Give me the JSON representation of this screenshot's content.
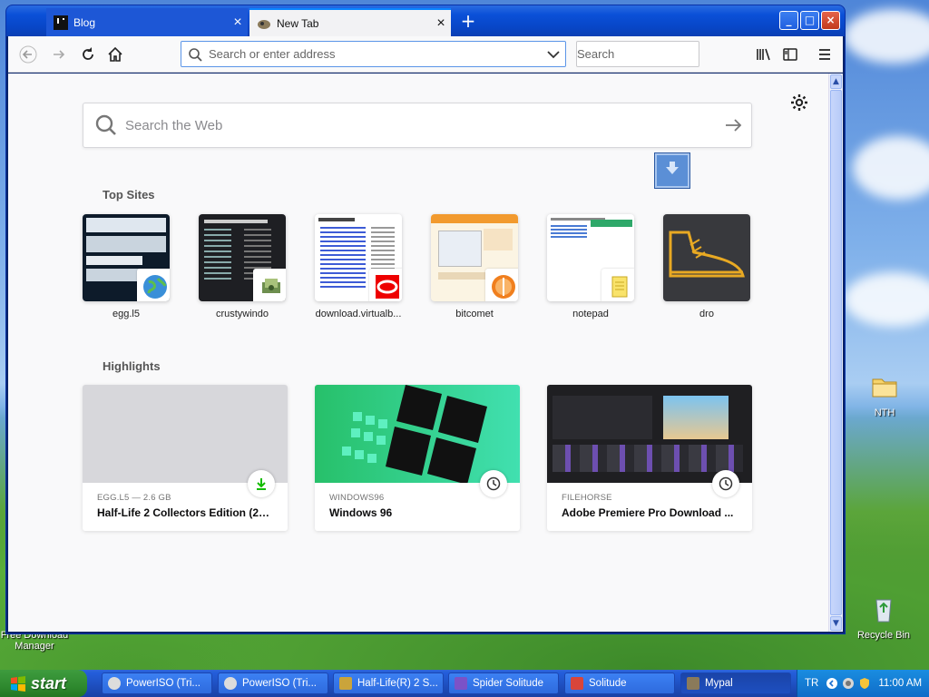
{
  "window": {
    "tabs": [
      {
        "label": "Blog",
        "icon": "blog-favicon"
      },
      {
        "label": "New Tab",
        "icon": "newtab-favicon"
      }
    ],
    "controls": {
      "minimize": "_",
      "maximize": "□",
      "close": "×"
    }
  },
  "toolbar": {
    "url_placeholder": "Search or enter address",
    "search_placeholder": "Search"
  },
  "newtab": {
    "web_search_placeholder": "Search the Web",
    "top_sites_title": "Top Sites",
    "top_sites": [
      {
        "name": "egg.l5",
        "badge": "globe-icon"
      },
      {
        "name": "crustywindo",
        "badge": "money-icon"
      },
      {
        "name": "download.virtualb...",
        "badge": "virtualbox-icon"
      },
      {
        "name": "bitcomet",
        "badge": "bitcomet-icon"
      },
      {
        "name": "notepad",
        "badge": "notepad-icon"
      },
      {
        "name": "dro",
        "badge": "sneaker-icon"
      }
    ],
    "highlights_title": "Highlights",
    "highlights": [
      {
        "source": "EGG.L5 — 2.6 GB",
        "title": "Half-Life 2 Collectors Edition (21...",
        "indicator": "download-icon"
      },
      {
        "source": "WINDOWS96",
        "title": "Windows 96",
        "indicator": "clock-icon"
      },
      {
        "source": "FILEHORSE",
        "title": "Adobe Premiere Pro Download ...",
        "indicator": "clock-icon"
      }
    ]
  },
  "desktop": {
    "icons": [
      {
        "label": "NTH"
      },
      {
        "label": "Recycle Bin"
      },
      {
        "label": "Free Download Manager"
      }
    ]
  },
  "taskbar": {
    "start_label": "start",
    "tasks": [
      {
        "label": "PowerISO (Tri..."
      },
      {
        "label": "PowerISO (Tri..."
      },
      {
        "label": "Half-Life(R) 2 S..."
      },
      {
        "label": "Spider Solitude"
      },
      {
        "label": "Solitude"
      },
      {
        "label": "Mypal"
      }
    ],
    "tray": {
      "language": "TR",
      "clock": "11:00 AM"
    }
  },
  "colors": {
    "accent": "#0a84ff",
    "titlebar": "#0a50d8",
    "start": "#2f8a2f"
  }
}
